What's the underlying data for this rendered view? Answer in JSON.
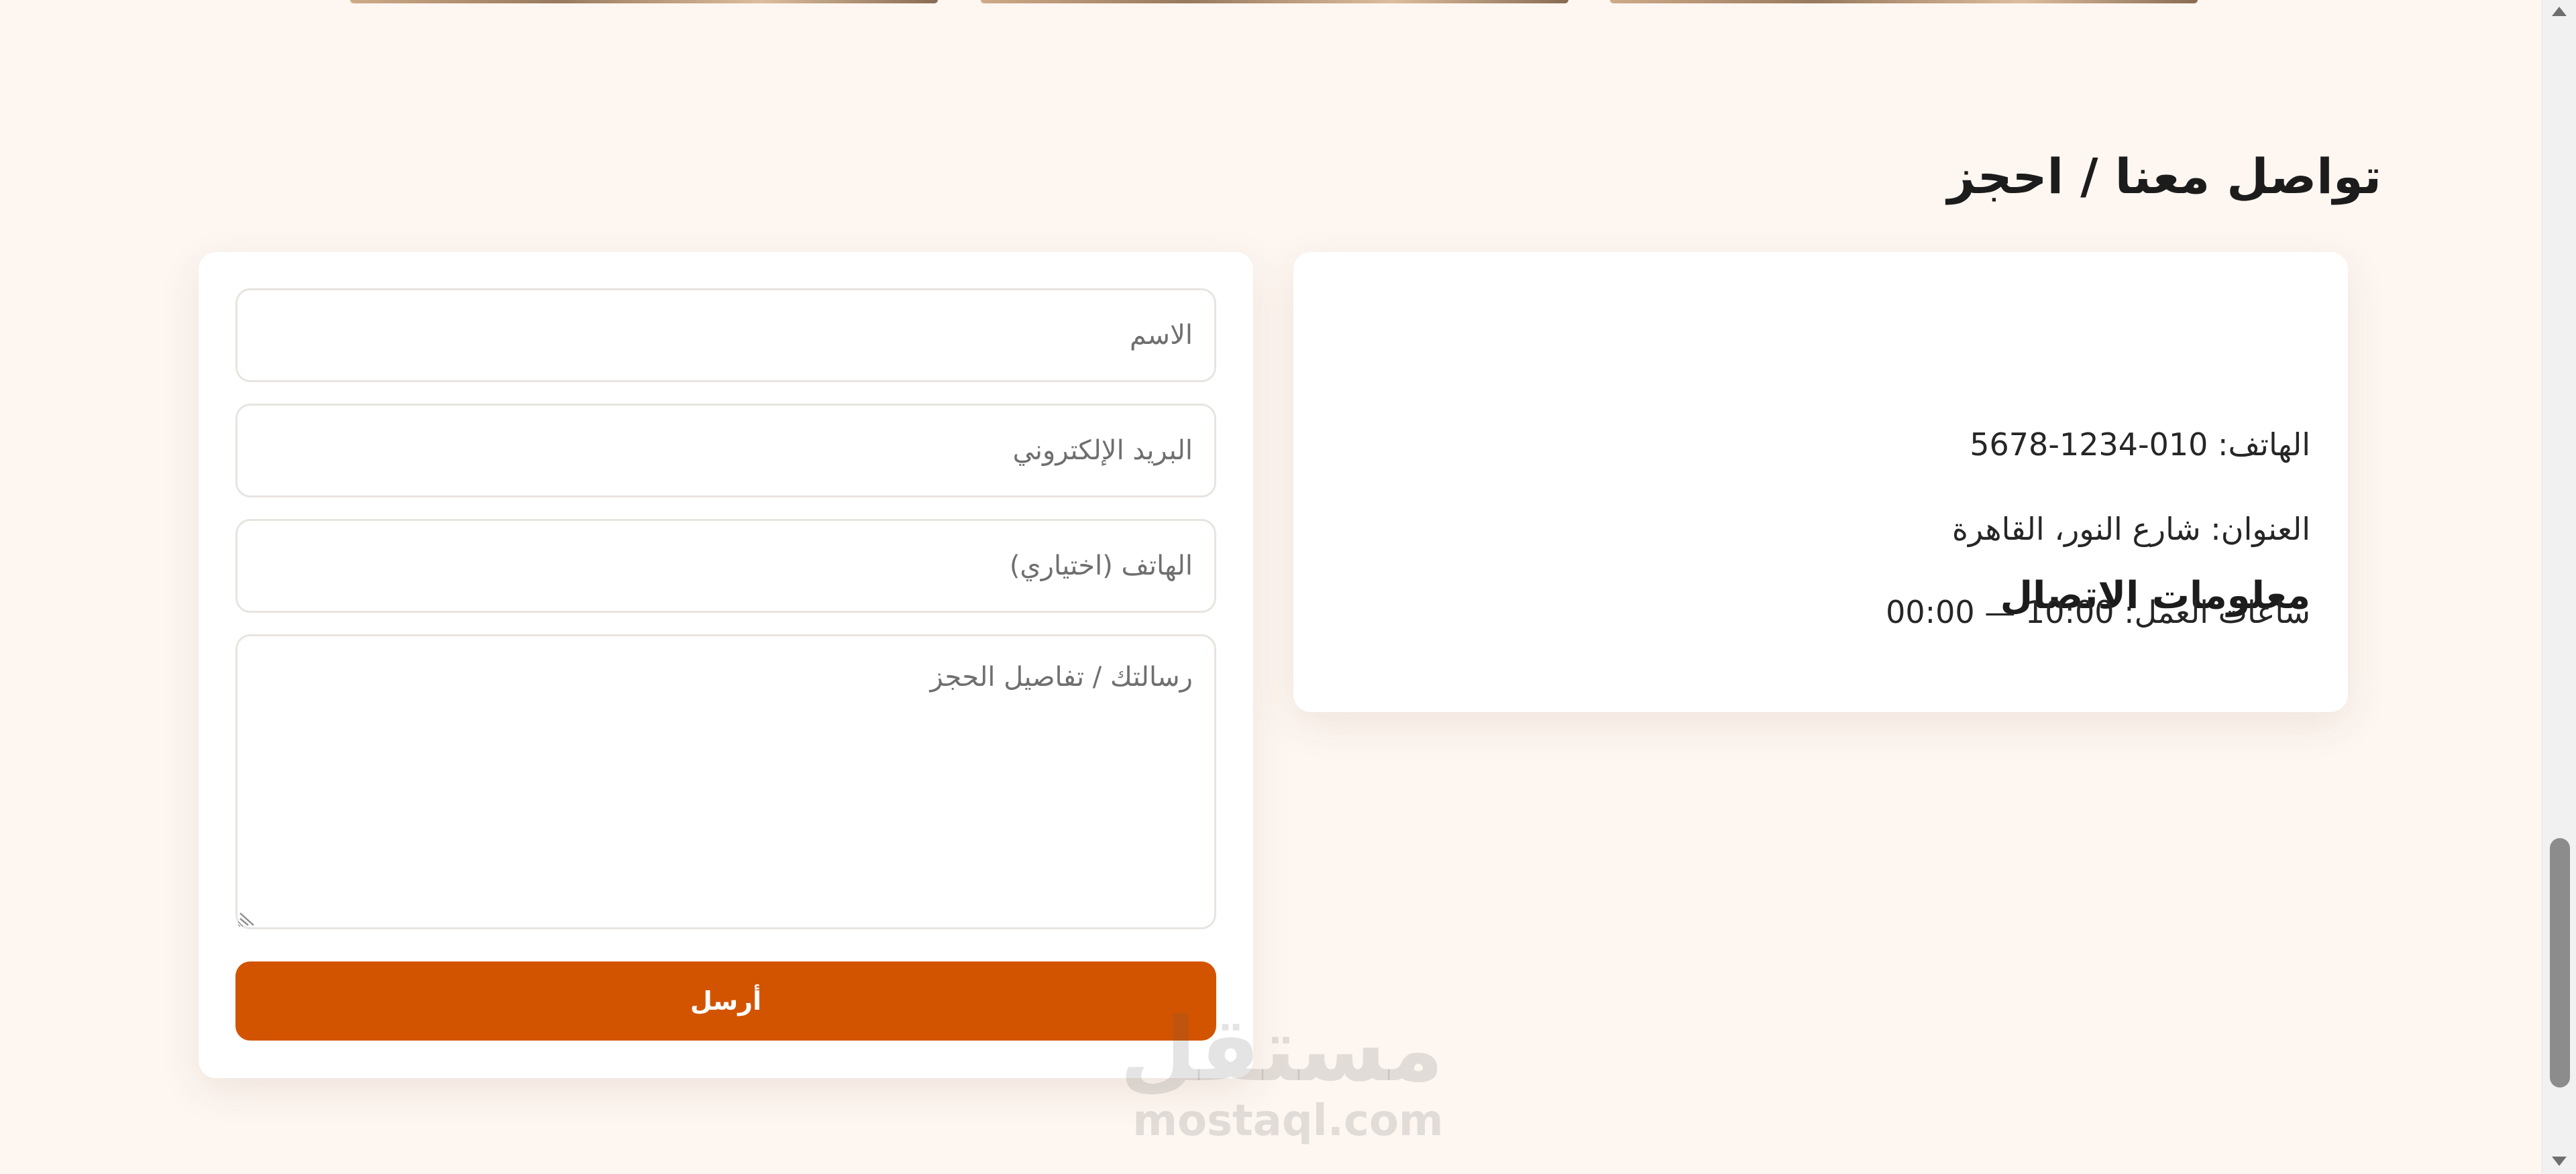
{
  "section": {
    "title": "تواصل معنا / احجز"
  },
  "contact_info": {
    "title": "معلومات الاتصال",
    "phone": "الهاتف: 010-1234-5678",
    "address": "العنوان: شارع النور، القاهرة",
    "hours": "ساعات العمل: 10:00 — 00:00"
  },
  "form": {
    "name_placeholder": "الاسم",
    "email_placeholder": "البريد الإلكتروني",
    "phone_placeholder": "الهاتف (اختياري)",
    "message_placeholder": "رسالتك / تفاصيل الحجز",
    "submit_label": "أرسل"
  },
  "watermark": {
    "arabic": "مستقل",
    "latin": "mostaql.com"
  },
  "colors": {
    "accent": "#d35400",
    "background": "#fdf6f1",
    "card": "#ffffff"
  },
  "icons": {
    "resize": "resize-grip-icon",
    "scroll_up": "scroll-up-icon",
    "scroll_down": "scroll-down-icon"
  }
}
